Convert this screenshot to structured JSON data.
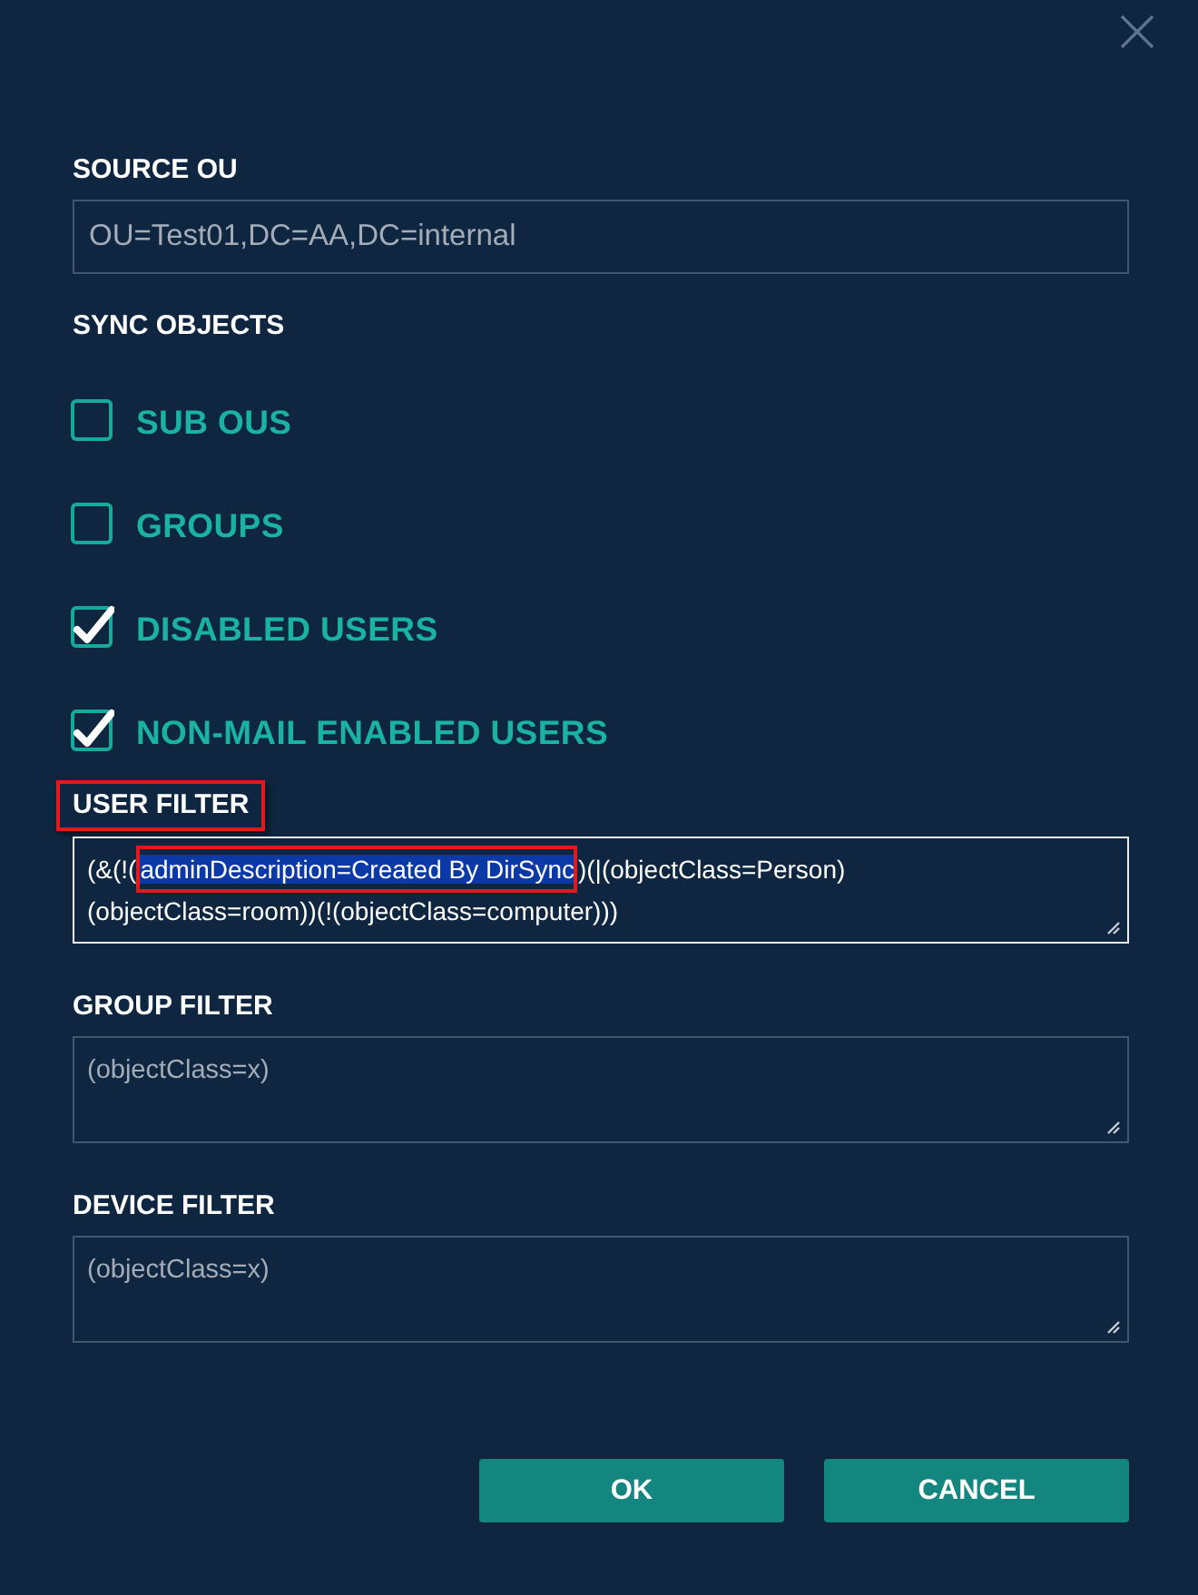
{
  "source_ou": {
    "label": "SOURCE OU",
    "value": "OU=Test01,DC=AA,DC=internal",
    "disabled": true
  },
  "sync_objects": {
    "label": "SYNC OBJECTS",
    "options": [
      {
        "label": "SUB OUS",
        "checked": false
      },
      {
        "label": "GROUPS",
        "checked": false
      },
      {
        "label": "DISABLED USERS",
        "checked": true
      },
      {
        "label": "NON-MAIL ENABLED USERS",
        "checked": true
      }
    ]
  },
  "filters": [
    {
      "label": "USER FILTER",
      "label_marked": true,
      "focused": true,
      "lines": [
        [
          {
            "text": "(&(!(",
            "selected": false,
            "marked": false
          },
          {
            "text": "adminDescription=Created By DirSync",
            "selected": true,
            "marked": true
          },
          {
            "text": ")(|(objectClass=Person)",
            "selected": false,
            "marked": false
          }
        ],
        [
          {
            "text": "(objectClass=room))(!(objectClass=computer)))",
            "selected": false,
            "marked": false
          }
        ]
      ]
    },
    {
      "label": "GROUP FILTER",
      "label_marked": false,
      "focused": false,
      "placeholder": "(objectClass=x)"
    },
    {
      "label": "DEVICE FILTER",
      "label_marked": false,
      "focused": false,
      "placeholder": "(objectClass=x)"
    }
  ],
  "buttons": [
    "OK",
    "CANCEL"
  ]
}
